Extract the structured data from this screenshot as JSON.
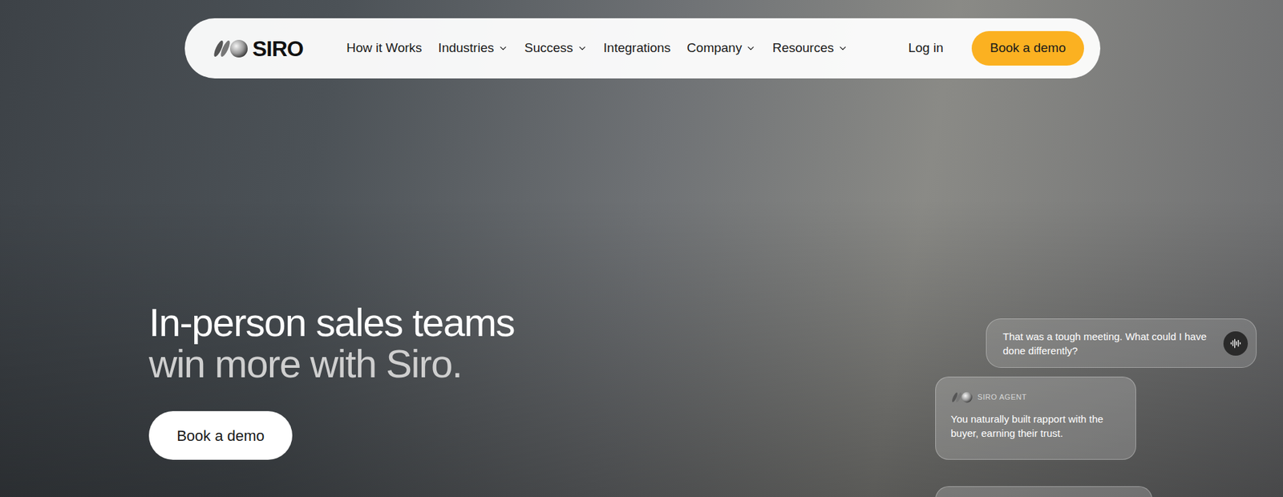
{
  "nav": {
    "logo": "SIRO",
    "items": [
      {
        "label": "How it Works",
        "dropdown": false
      },
      {
        "label": "Industries",
        "dropdown": true
      },
      {
        "label": "Success",
        "dropdown": true
      },
      {
        "label": "Integrations",
        "dropdown": false
      },
      {
        "label": "Company",
        "dropdown": true
      },
      {
        "label": "Resources",
        "dropdown": true
      }
    ],
    "login": "Log in",
    "cta": "Book a demo"
  },
  "hero": {
    "headline": "In-person sales teams",
    "subheadline": "win more with Siro.",
    "cta": "Book a demo"
  },
  "chat": [
    {
      "kind": "user",
      "text": "That was a tough meeting. What could I have done differently?"
    },
    {
      "kind": "agent",
      "sender": "SIRO AGENT",
      "text": "You naturally built rapport with the buyer, earning their trust."
    }
  ]
}
